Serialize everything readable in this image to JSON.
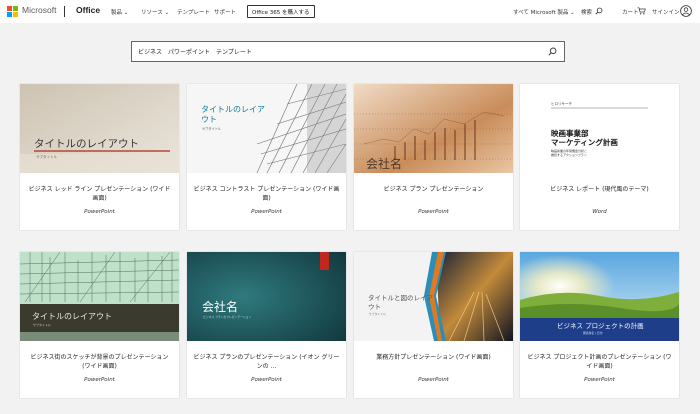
{
  "header": {
    "brand": "Microsoft",
    "product": "Office",
    "nav": [
      "製品",
      "リソース",
      "テンプレート",
      "サポート"
    ],
    "buy_button": "Office 365 を購入する",
    "all_products": "すべて Microsoft 製品",
    "search": "検索",
    "cart": "カート",
    "sign_in": "サインイン"
  },
  "search": {
    "value": "ビジネス　パワーポイント　テンプレート"
  },
  "colors": {
    "ms_red": "#f25022",
    "ms_green": "#7fba00",
    "ms_blue": "#00a4ef",
    "ms_yellow": "#ffb900"
  },
  "templates": [
    {
      "title": "ビジネス レッド ライン プレゼンテーション (ワイド画面)",
      "app": "PowerPoint",
      "thumb_title": "タイトルのレイアウト",
      "thumb_subtitle": "サブタイトル"
    },
    {
      "title": "ビジネス コントラスト プレゼンテーション (ワイド画面)",
      "app": "PowerPoint",
      "thumb_title_line1": "タイトルのレイア",
      "thumb_title_line2": "ウト",
      "thumb_subtitle": "サブタイトル"
    },
    {
      "title": "ビジネス プラン プレゼンテーション",
      "app": "PowerPoint",
      "thumb_title": "会社名"
    },
    {
      "title": "ビジネス レポート (現代風のテーマ)",
      "app": "Word",
      "thumb_label": "ヒロリサーチ",
      "thumb_title_line1": "映画事業部",
      "thumb_title_line2": "マーケティング計画",
      "thumb_sub_line1": "映画産業の年間機会分析と",
      "thumb_sub_line2": "推奨するアクションプラン"
    },
    {
      "title": "ビジネス街のスケッチが背景のプレゼンテーション (ワイド画面)",
      "app": "PowerPoint",
      "thumb_title": "タイトルのレイアウト",
      "thumb_subtitle": "サブタイトル"
    },
    {
      "title": "ビジネス プランのプレゼンテーション (イオン グリーンの ...",
      "app": "PowerPoint",
      "thumb_title": "会社名",
      "thumb_subtitle": "ビジネス プランのプレゼンテーション"
    },
    {
      "title": "業務方針プレゼンテーション (ワイド画面)",
      "app": "PowerPoint",
      "thumb_title_line1": "タイトルと図のレイア",
      "thumb_title_line2": "ウト",
      "thumb_subtitle": "サブタイトル"
    },
    {
      "title": "ビジネス プロジェクト計画のプレゼンテーション (ワイド画面)",
      "app": "PowerPoint",
      "thumb_title": "ビジネス プロジェクトの計画",
      "thumb_subtitle": "発表者名 | 日付"
    }
  ]
}
